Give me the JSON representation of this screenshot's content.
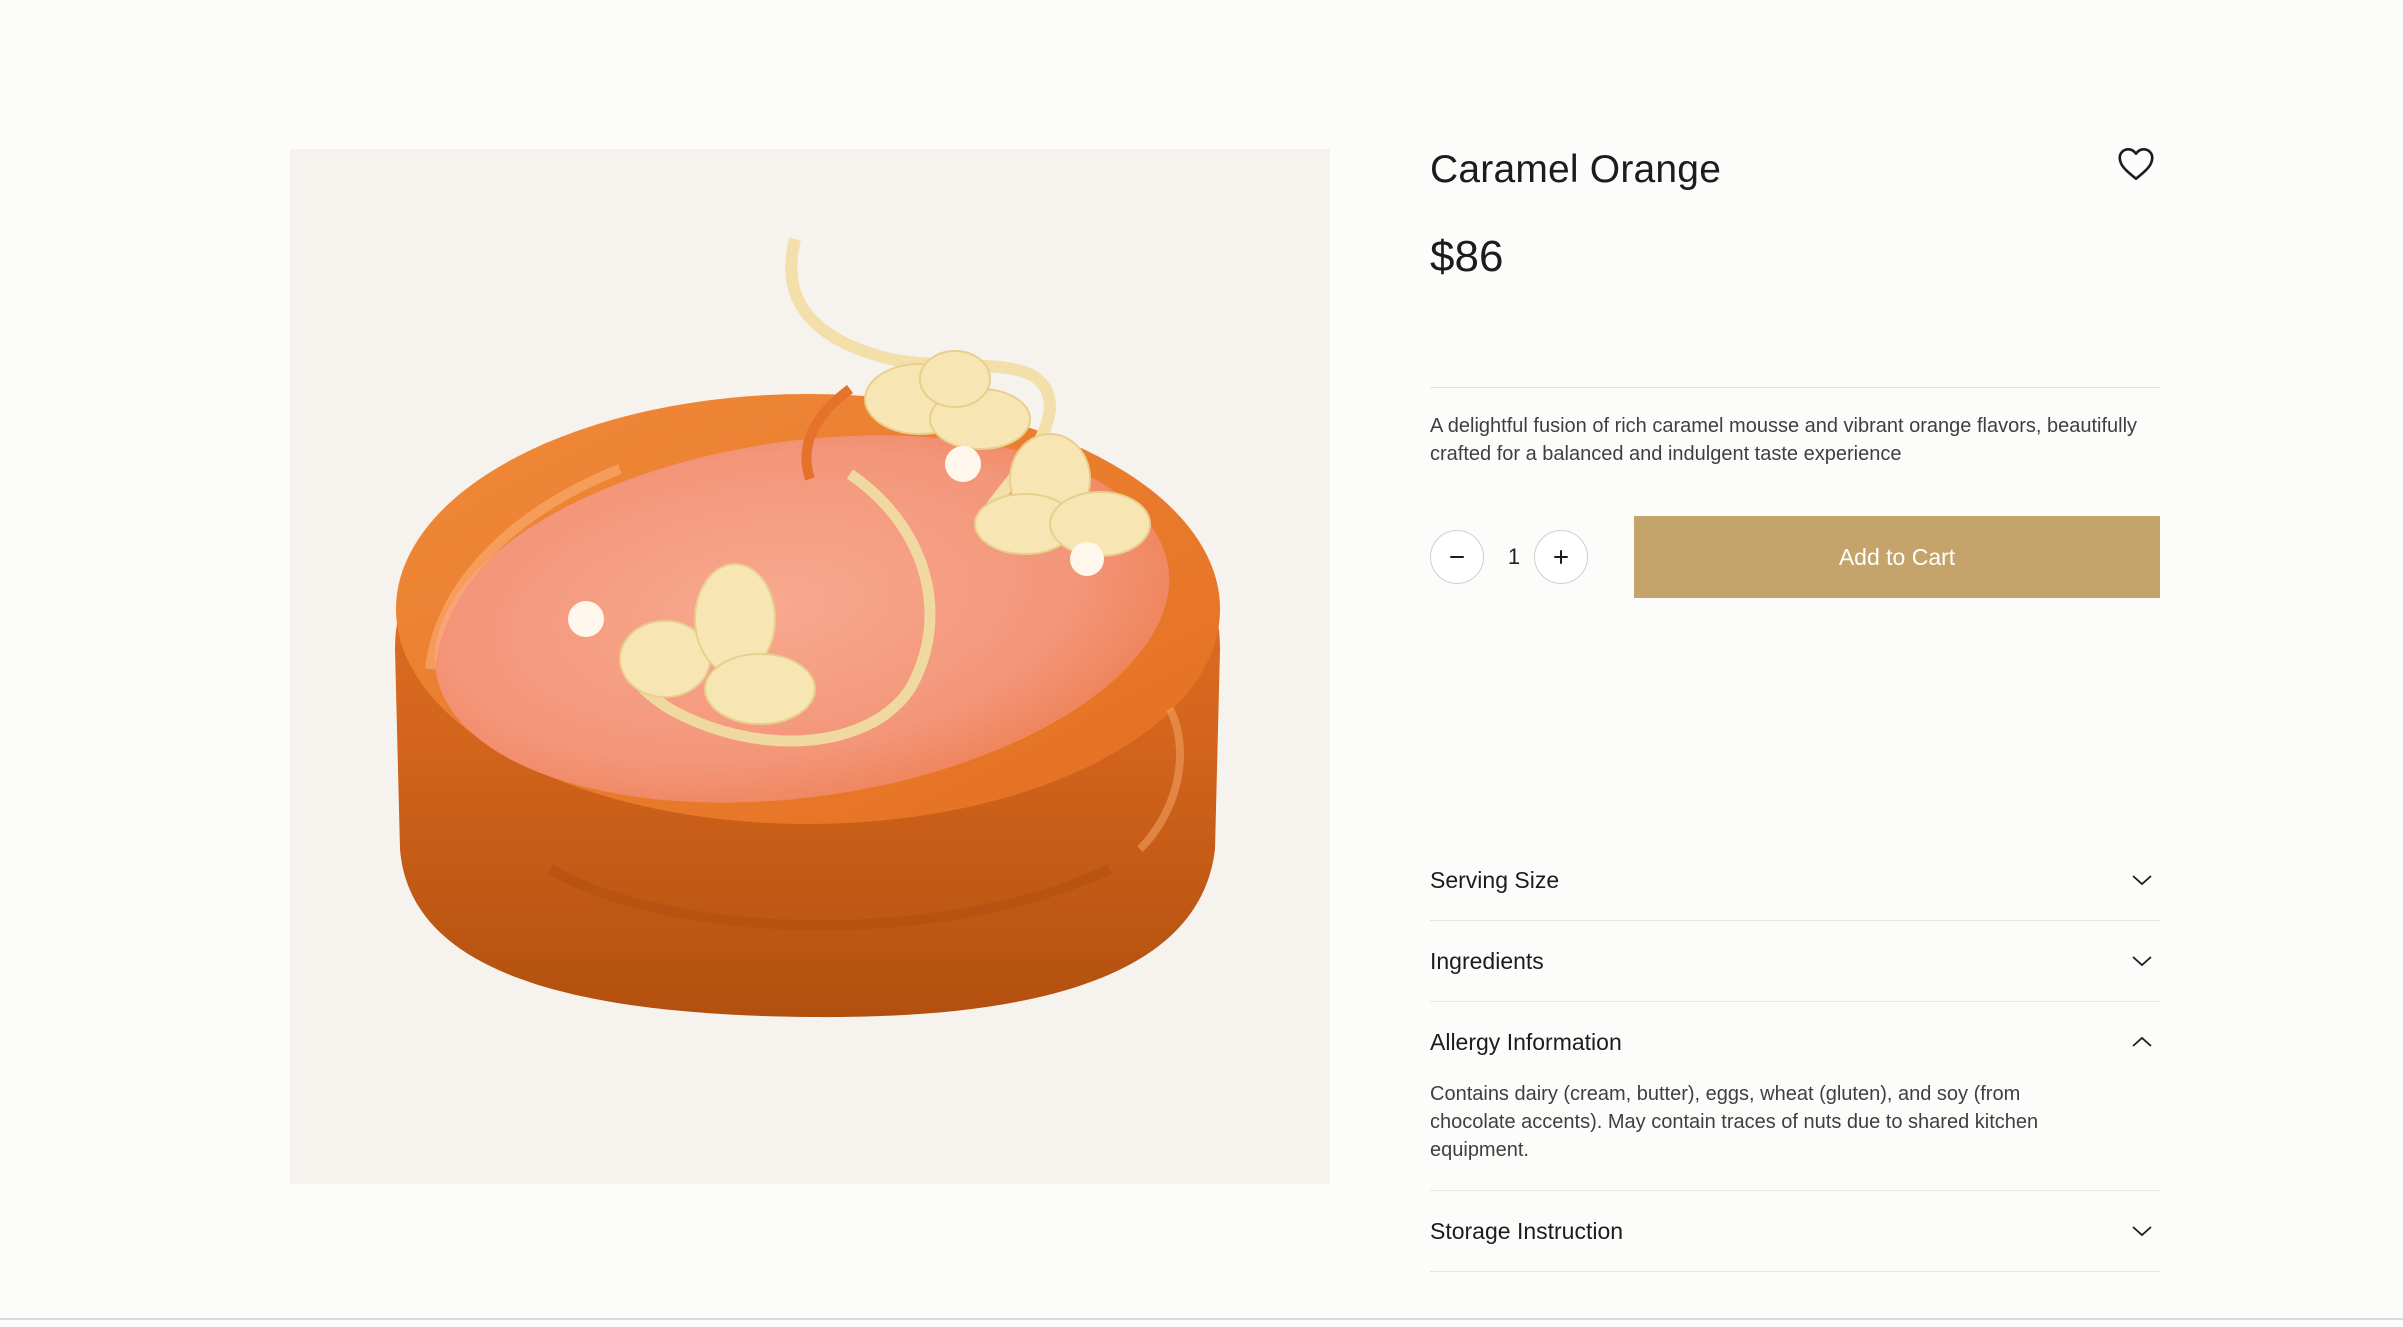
{
  "product": {
    "title": "Caramel Orange",
    "price": "$86",
    "description": "A delightful fusion of rich caramel mousse and vibrant orange flavors, beautifully crafted for a balanced and indulgent taste experience"
  },
  "purchase": {
    "quantity": "1",
    "decrease_icon": "minus-icon",
    "increase_icon": "plus-icon",
    "add_to_cart_label": "Add to Cart",
    "button_color": "#c4a46b"
  },
  "wishlist": {
    "icon": "heart-outline-icon"
  },
  "accordion": [
    {
      "title": "Serving Size",
      "expanded": false,
      "body": ""
    },
    {
      "title": "Ingredients",
      "expanded": false,
      "body": ""
    },
    {
      "title": "Allergy Information",
      "expanded": true,
      "body": "Contains dairy (cream, butter), eggs, wheat (gluten), and soy (from chocolate accents). May contain traces of nuts due to shared kitchen equipment."
    },
    {
      "title": "Storage Instruction",
      "expanded": false,
      "body": ""
    }
  ],
  "image": {
    "subject": "orange glazed mousse cake with white chocolate flowers",
    "background_color": "#f6f2ee"
  }
}
